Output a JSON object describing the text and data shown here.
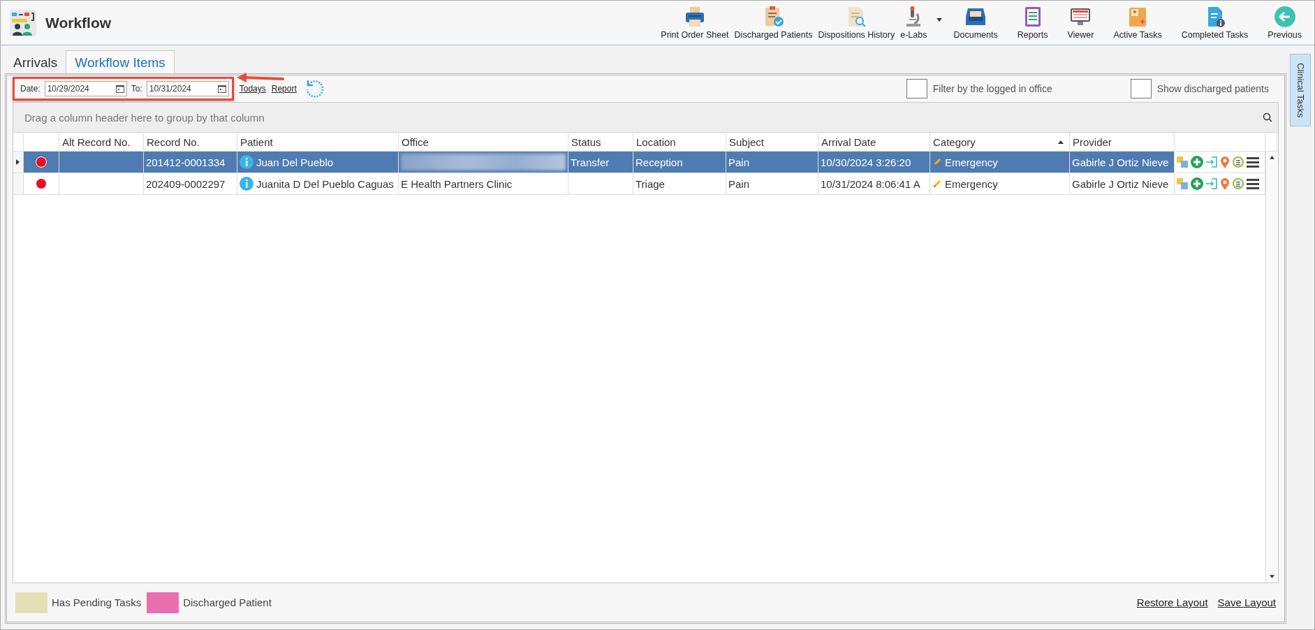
{
  "window": {
    "title": "Workflow"
  },
  "toolbar": [
    {
      "kind": "printer",
      "label": "Print Order Sheet",
      "dropdown": false
    },
    {
      "kind": "clipboard-check",
      "label": "Discharged Patients",
      "dropdown": false
    },
    {
      "kind": "document-search",
      "label": "Dispositions History",
      "dropdown": false
    },
    {
      "kind": "microscope",
      "label": "e-Labs",
      "dropdown": true
    },
    {
      "kind": "tray",
      "label": "Documents",
      "dropdown": false
    },
    {
      "kind": "report",
      "label": "Reports",
      "dropdown": false
    },
    {
      "kind": "monitor",
      "label": "Viewer",
      "dropdown": false
    },
    {
      "kind": "folder",
      "label": "Active Tasks",
      "dropdown": false
    },
    {
      "kind": "document-info",
      "label": "Completed Tasks",
      "dropdown": false
    },
    {
      "kind": "back",
      "label": "Previous",
      "dropdown": false
    }
  ],
  "tabs": [
    {
      "label": "Arrivals",
      "selected": false
    },
    {
      "label": "Workflow Items",
      "selected": true
    }
  ],
  "side_tab": {
    "label": "Clinical Tasks"
  },
  "filters": {
    "date_label": "Date:",
    "date_from": "10/29/2024",
    "to_label": "To:",
    "date_to": "10/31/2024",
    "todays_link": "Todays",
    "report_link": "Report",
    "checkboxes": [
      {
        "label": "Filter by the logged in office",
        "checked": false
      },
      {
        "label": "Show discharged patients",
        "checked": false
      }
    ]
  },
  "table": {
    "group_panel": "Drag a column header here to group by that column",
    "columns": [
      {
        "label": "Alt Record No.",
        "sorted": false
      },
      {
        "label": "Record No.",
        "sorted": false
      },
      {
        "label": "Patient",
        "sorted": false
      },
      {
        "label": "Office",
        "sorted": false
      },
      {
        "label": "Status",
        "sorted": false
      },
      {
        "label": "Location",
        "sorted": false
      },
      {
        "label": "Subject",
        "sorted": false
      },
      {
        "label": "Arrival Date",
        "sorted": false
      },
      {
        "label": "Category",
        "sorted": true
      },
      {
        "label": "Provider",
        "sorted": false
      }
    ],
    "rows": [
      {
        "selected": true,
        "color": "#e81123",
        "alt_record": "",
        "record": "201412-0001334",
        "patient": "Juan Del Pueblo",
        "office": "",
        "office_blurred": true,
        "status": "Transfer",
        "location": "Reception",
        "subject": "Pain",
        "arrival": "10/30/2024 3:26:20",
        "category": "Emergency",
        "provider": "Gabirle J Ortiz Nieve"
      },
      {
        "selected": false,
        "color": "#e81123",
        "alt_record": "",
        "record": "202409-0002297",
        "patient": "Juanita D Del Pueblo Caguas",
        "office": "E Health Partners Clinic",
        "office_blurred": false,
        "status": "",
        "location": "Triage",
        "subject": "Pain",
        "arrival": "10/31/2024 8:06:41 A",
        "category": "Emergency",
        "provider": "Gabirle J Ortiz Nieve"
      }
    ]
  },
  "legend": [
    {
      "label": "Has Pending Tasks",
      "color": "#e5dfb5"
    },
    {
      "label": "Discharged Patient",
      "color": "#e870b0"
    }
  ],
  "footer_links": [
    "Restore Layout",
    "Save Layout"
  ]
}
